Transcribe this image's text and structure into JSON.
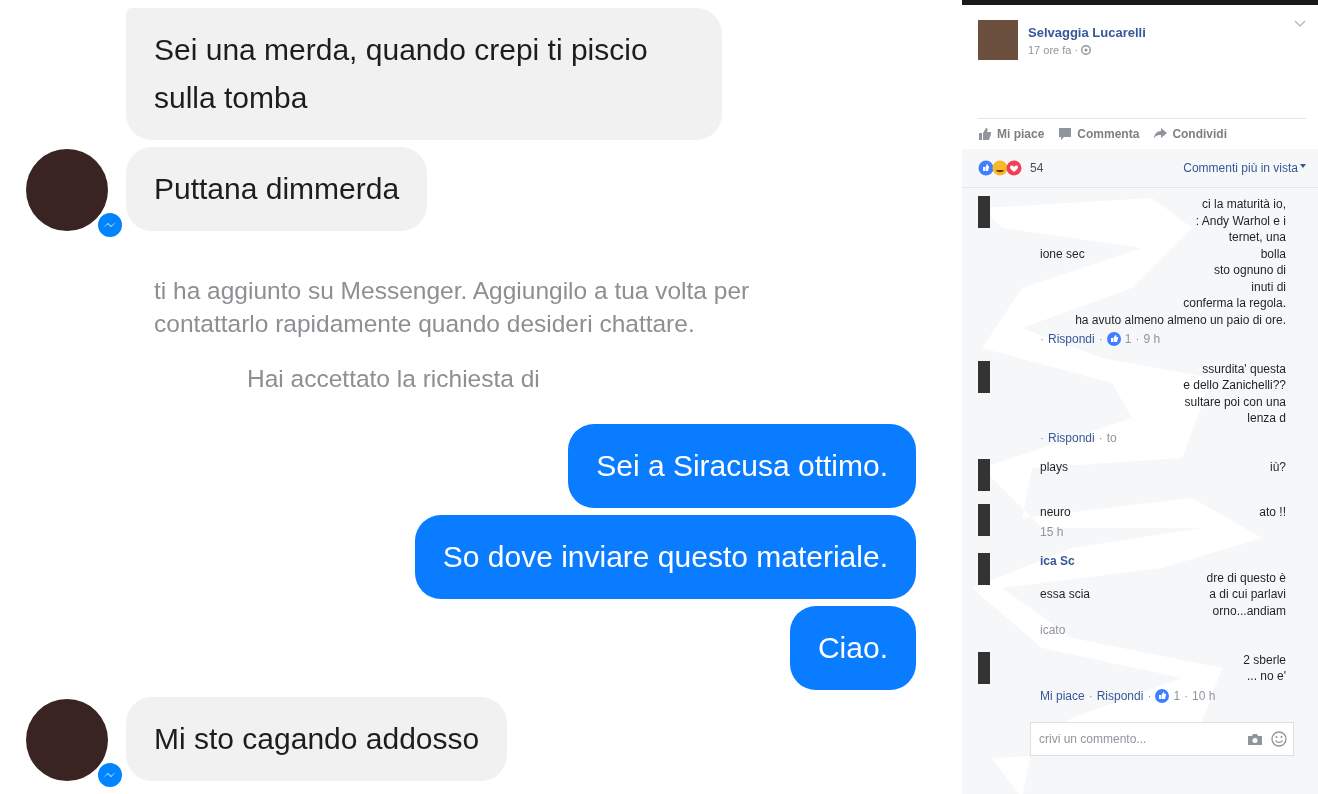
{
  "chat": {
    "messages": [
      {
        "kind": "incoming",
        "avatar": false,
        "text": "Sei una merda, quando crepi ti piscio sulla tomba"
      },
      {
        "kind": "incoming",
        "avatar": true,
        "text": "Puttana dimmerda"
      },
      {
        "kind": "notice",
        "text": "ti ha aggiunto su Messenger. Aggiungilo a tua volta per contattarlo rapidamente quando desideri chattare."
      },
      {
        "kind": "status",
        "text": "Hai accettato la richiesta di"
      },
      {
        "kind": "outgoing",
        "text": "Sei a Siracusa ottimo."
      },
      {
        "kind": "outgoing",
        "text": "So dove inviare questo materiale."
      },
      {
        "kind": "outgoing",
        "text": "Ciao."
      },
      {
        "kind": "incoming",
        "avatar": true,
        "text": "Mi sto cagando addosso"
      }
    ]
  },
  "post": {
    "author": "Selvaggia Lucarelli",
    "time": "17 ore fa ·",
    "actions": [
      {
        "kind": "like",
        "label": "Mi piace"
      },
      {
        "kind": "comment",
        "label": "Commenta"
      },
      {
        "kind": "share",
        "label": "Condividi"
      }
    ],
    "reaction_count": "54",
    "sort": "Commenti più in vista",
    "comments": [
      {
        "lines": [
          [
            "ci la maturità io,"
          ],
          [
            ": Andy Warhol e i"
          ],
          [
            "ternet, una"
          ],
          [
            "ione sec",
            "bolla"
          ],
          [
            "sto ognuno di"
          ],
          [
            "inuti di"
          ],
          [
            "conferma la regola."
          ],
          [
            "ha avuto almeno almeno un paio di ore."
          ]
        ],
        "meta": [
          {
            "kind": "sep",
            "text": "·"
          },
          {
            "kind": "link",
            "text": "Rispondi"
          },
          {
            "kind": "sep",
            "text": "·"
          },
          {
            "kind": "likes",
            "text": "1"
          },
          {
            "kind": "sep",
            "text": "·"
          },
          {
            "kind": "time",
            "text": "9 h"
          }
        ]
      },
      {
        "lines": [
          [
            "ssurdita' questa"
          ],
          [
            "e dello Zanichelli??"
          ],
          [
            "sultare poi con una"
          ],
          [
            "lenza d"
          ]
        ],
        "meta": [
          {
            "kind": "sep",
            "text": "·"
          },
          {
            "kind": "link",
            "text": "Rispondi"
          },
          {
            "kind": "sep",
            "text": "·"
          },
          {
            "kind": "time",
            "text": "to"
          }
        ]
      },
      {
        "lines": [
          [
            "plays",
            "iù?"
          ]
        ]
      },
      {
        "lines": [
          [
            "neuro",
            "ato !!"
          ]
        ],
        "meta": [
          {
            "kind": "time",
            "text": "15 h"
          }
        ]
      },
      {
        "author": "ica Sc",
        "lines": [
          [
            "dre di questo è"
          ],
          [
            "essa scia",
            "a di cui parlavi"
          ],
          [
            "orno...andiam"
          ]
        ],
        "meta": [
          {
            "kind": "time",
            "text": "icato"
          }
        ]
      },
      {
        "lines": [
          [
            "2 sberle"
          ],
          [
            "... no e'"
          ]
        ],
        "meta": [
          {
            "kind": "link",
            "text": "Mi piace"
          },
          {
            "kind": "sep",
            "text": "·"
          },
          {
            "kind": "link",
            "text": "Rispondi"
          },
          {
            "kind": "sep",
            "text": "·"
          },
          {
            "kind": "likes",
            "text": "1"
          },
          {
            "kind": "sep",
            "text": "·"
          },
          {
            "kind": "time",
            "text": "10 h"
          }
        ]
      }
    ],
    "comment_placeholder": "crivi un commento..."
  }
}
